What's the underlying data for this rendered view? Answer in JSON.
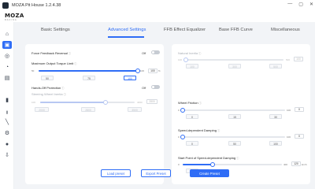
{
  "window": {
    "title": "MOZA Pit House 1.2.4.38",
    "minimize": "—",
    "maximize": "▢",
    "close": "✕"
  },
  "brand": {
    "name": "MOZA",
    "sub": "RACING"
  },
  "sidebar": {
    "items": [
      {
        "icon": "home-icon",
        "glyph": "⌂",
        "active": false
      },
      {
        "icon": "wheelbase-icon",
        "glyph": "▣",
        "active": true
      },
      {
        "icon": "steering-wheel-icon",
        "glyph": "◎",
        "active": false
      },
      {
        "icon": "gauge-icon",
        "glyph": "◔",
        "active": false
      },
      {
        "icon": "dashboard-icon",
        "glyph": "▤",
        "active": false
      },
      {
        "icon": "pedals-icon",
        "glyph": "▮",
        "active": false
      },
      {
        "icon": "shifter-icon",
        "glyph": "╻",
        "active": false
      },
      {
        "icon": "handbrake-icon",
        "glyph": "╲",
        "active": false
      },
      {
        "icon": "settings-icon",
        "glyph": "⚙",
        "active": false
      },
      {
        "icon": "account-icon",
        "glyph": "●",
        "active": false
      },
      {
        "icon": "download-icon",
        "glyph": "⇩",
        "active": false
      }
    ]
  },
  "tabs": [
    {
      "label": "Basic Settings",
      "active": false
    },
    {
      "label": "Advanced Settings",
      "active": true
    },
    {
      "label": "FFB Effect Equalizer",
      "active": false
    },
    {
      "label": "Base FFB Curve",
      "active": false
    },
    {
      "label": "Miscellaneous",
      "active": false
    }
  ],
  "left": {
    "ffb_reversal": {
      "label": "Force Feedback Reversal",
      "state": "Off"
    },
    "torque_limit": {
      "label": "Maximum Output Torque Limit",
      "min": "50",
      "max": "100",
      "value": "100",
      "unit": "%",
      "level": 1.0,
      "presets": [
        {
          "label": "50",
          "active": false
        },
        {
          "label": "75",
          "active": false
        },
        {
          "label": "100",
          "active": true
        }
      ]
    },
    "hands_off": {
      "label": "Hands-Off Protection",
      "state": "Off"
    },
    "steering_inertia": {
      "label": "Steering Wheel Inertia",
      "min": "100",
      "max": "4000",
      "value": "2800",
      "level": 0.69,
      "presets": [
        {
          "label": "2000"
        },
        {
          "label": "2800"
        },
        {
          "label": "3500"
        }
      ]
    }
  },
  "right": {
    "natural_inertia": {
      "label": "Natural Inertia",
      "min": "100",
      "max": "500",
      "value": "100",
      "level": 0.0,
      "presets": [
        {
          "label": "100"
        },
        {
          "label": "300"
        },
        {
          "label": "500"
        }
      ]
    },
    "wheel_friction": {
      "label": "Wheel Friction",
      "min": "0",
      "max": "100",
      "value": "0",
      "level": 0.0,
      "presets": [
        {
          "label": "0"
        },
        {
          "label": "15"
        },
        {
          "label": "30"
        }
      ]
    },
    "speed_damping": {
      "label": "Speed-dependent Damping",
      "min": "0",
      "max": "100",
      "value": "0",
      "level": 0.0,
      "presets": [
        {
          "label": "0"
        },
        {
          "label": "50"
        },
        {
          "label": "100"
        }
      ]
    },
    "damping_start": {
      "label": "Start Point of Speed-dependent Damping",
      "min": "0",
      "max": "400",
      "value": "120",
      "unit": "km/h",
      "level": 0.3,
      "presets": [
        {
          "label": "120"
        }
      ]
    }
  },
  "buttons": {
    "load": "Load preset",
    "export": "Export Preset",
    "create": "Create Preset"
  },
  "colors": {
    "accent": "#2f6df6",
    "background": "#f2f4f7",
    "card": "#ffffff"
  }
}
